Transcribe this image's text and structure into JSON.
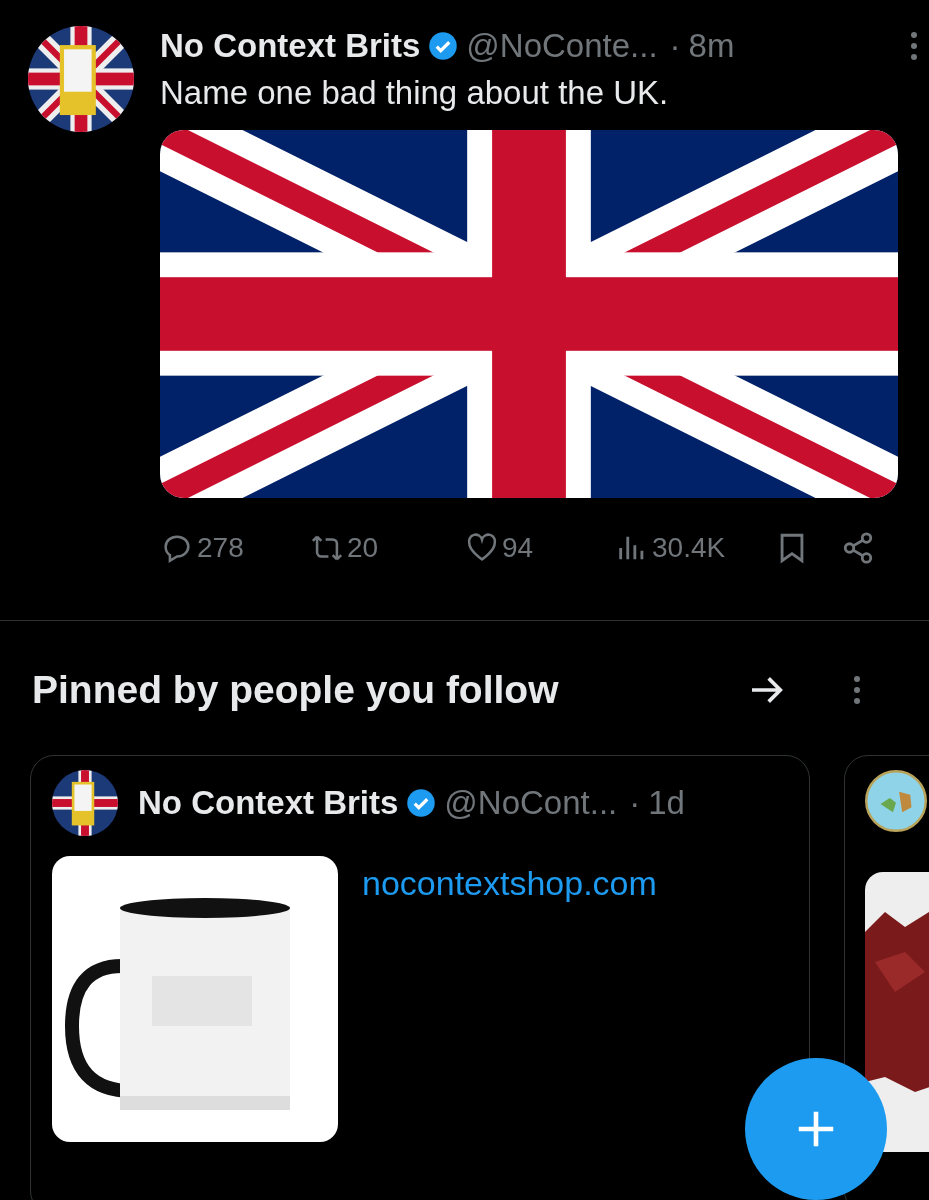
{
  "tweet": {
    "author": "No Context Brits",
    "verified": true,
    "handle": "@NoConte...",
    "separator": "·",
    "time": "8m",
    "text": "Name one bad thing about the UK.",
    "actions": [
      {
        "kind": "reply",
        "count": "278"
      },
      {
        "kind": "repost",
        "count": "20"
      },
      {
        "kind": "like",
        "count": "94"
      },
      {
        "kind": "views",
        "count": "30.4K"
      },
      {
        "kind": "bookmark"
      },
      {
        "kind": "share"
      }
    ]
  },
  "pinned": {
    "title": "Pinned by people you follow",
    "cards": [
      {
        "author": "No Context Brits",
        "verified": true,
        "handle": "@NoCont...",
        "separator": "·",
        "time": "1d",
        "link": "nocontextshop.com"
      }
    ]
  },
  "compose_button": {
    "kind": "plus"
  }
}
